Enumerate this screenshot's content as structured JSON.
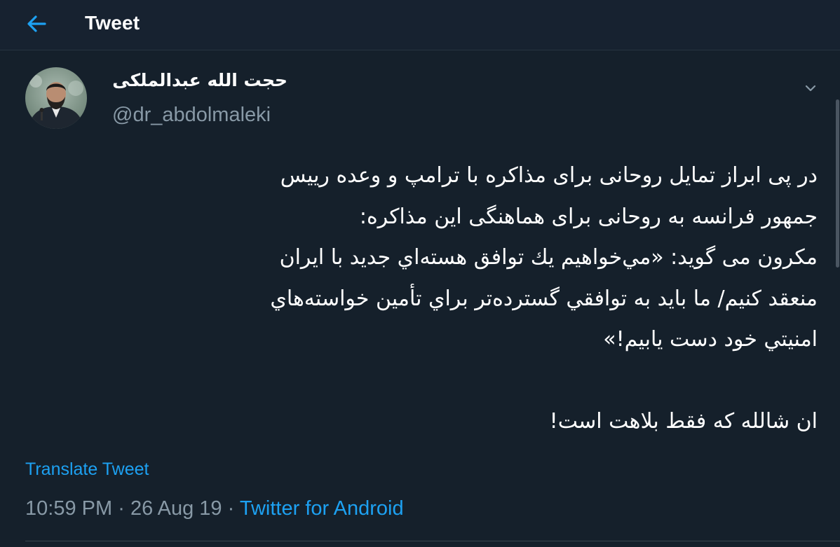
{
  "header": {
    "title": "Tweet",
    "back_icon": "arrow-left-icon"
  },
  "colors": {
    "background": "#15202b",
    "accent": "#1da1f2",
    "secondary_text": "#8899a6"
  },
  "tweet": {
    "author_name": "حجت الله عبدالملکی",
    "author_handle": "@dr_abdolmaleki",
    "menu_icon": "chevron-down-icon",
    "body_lines": [
      "در پی ابراز تمایل روحانی برای مذاکره با ترامپ و وعده رییس",
      "جمهور فرانسه به روحانی برای هماهنگی این مذاکره:",
      "مکرون می گوید: «مي‌خواهيم يك توافق هسته‌اي جديد با ايران",
      "منعقد كنيم/ ما بايد به توافقي گسترده‌تر براي تأمين خواسته‌هاي",
      "امنيتي خود دست يابيم!»",
      "",
      "ان شالله که فقط بلاهت است!"
    ],
    "translate_label": "Translate Tweet",
    "time": "10:59 PM",
    "separator": "·",
    "date": "26 Aug 19",
    "source": "Twitter for Android"
  }
}
